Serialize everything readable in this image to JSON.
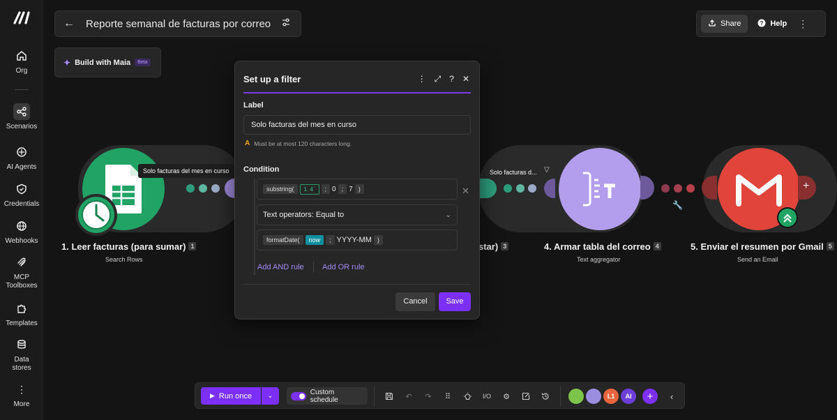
{
  "sidebar": {
    "items": [
      {
        "label": "Org",
        "icon": "home-icon"
      },
      {
        "label": "Scenarios",
        "icon": "share-nodes-icon"
      },
      {
        "label": "AI Agents",
        "icon": "sparkle-plus-icon"
      },
      {
        "label": "Credentials",
        "icon": "shield-check-icon"
      },
      {
        "label": "Webhooks",
        "icon": "globe-icon"
      },
      {
        "label": "MCP",
        "label2": "Toolboxes",
        "icon": "mcp-icon"
      },
      {
        "label": "Templates",
        "icon": "puzzle-icon"
      },
      {
        "label": "Data",
        "label2": "stores",
        "icon": "database-icon"
      },
      {
        "label": "More",
        "icon": "dots-vertical-icon"
      }
    ]
  },
  "header": {
    "title": "Reporte semanal de facturas por correo",
    "share_label": "Share",
    "help_label": "Help"
  },
  "maia": {
    "label": "Build with Maia",
    "badge": "Beta"
  },
  "modules": [
    {
      "title": "1. Leer facturas (para sumar)",
      "num": "1",
      "sub": "Search Rows",
      "color": "#21a366"
    },
    {
      "title": "star)",
      "num": "3"
    },
    {
      "title": "4. Armar tabla del correo",
      "num": "4",
      "sub": "Text aggregator",
      "color": "#b39ded"
    },
    {
      "title": "5. Enviar el resumen por Gmail",
      "num": "5",
      "sub": "Send an Email",
      "color": "#e0443a"
    }
  ],
  "connectors": {
    "first_label": "Solo facturas del mes en curso",
    "second_label": "Solo facturas d..."
  },
  "filter_modal": {
    "title": "Set up a filter",
    "label_heading": "Label",
    "label_value": "Solo facturas del mes en curso",
    "hint": "Must be at most 120 characters long.",
    "condition_heading": "Condition",
    "operand1": {
      "fn": "substring(",
      "arg1": "1. 4`",
      "sep1": ";",
      "arg2": "0",
      "sep2": ";",
      "arg3": "7",
      "close": ")"
    },
    "operator": "Text operators: Equal to",
    "operand2": {
      "fn": "formatDate(",
      "arg1": "now",
      "sep1": ";",
      "arg2": "YYYY-MM",
      "close": ")"
    },
    "add_and": "Add AND rule",
    "add_or": "Add OR rule",
    "cancel": "Cancel",
    "save": "Save"
  },
  "toolbar": {
    "run_label": "Run once",
    "schedule_label": "Custom schedule",
    "badges": [
      {
        "text": "",
        "color": "#7cc44a"
      },
      {
        "text": "",
        "color": "#9b8ee0"
      },
      {
        "text": "L1",
        "color": "#e8643c"
      },
      {
        "text": "AI",
        "color": "#6d3fd9"
      }
    ]
  }
}
